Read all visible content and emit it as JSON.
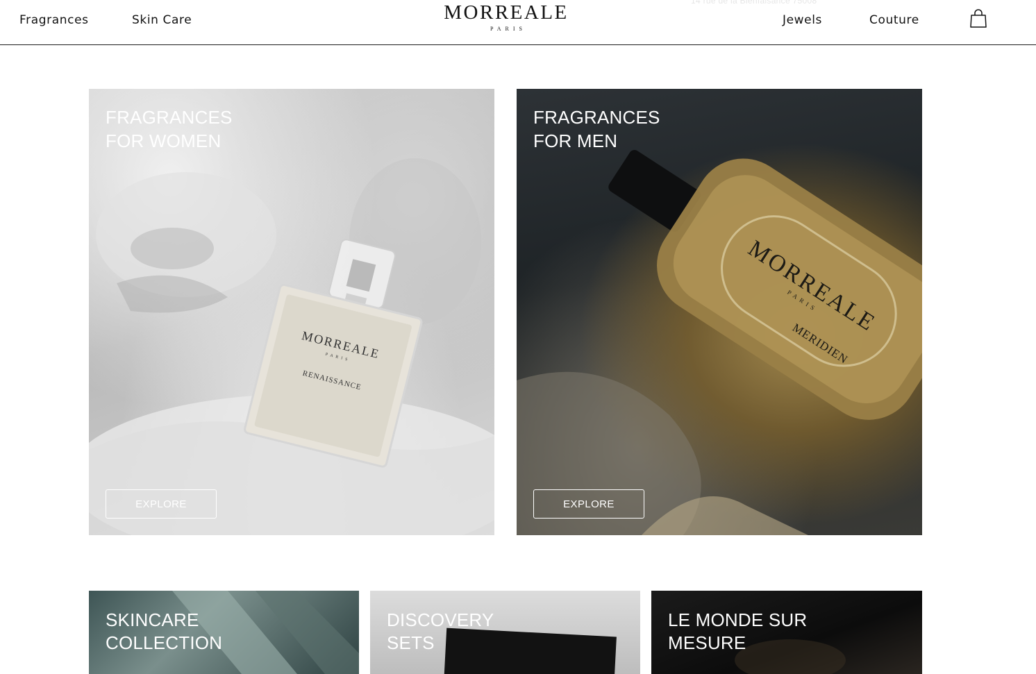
{
  "header": {
    "nav_left": [
      "Fragrances",
      "Skin Care"
    ],
    "nav_right": [
      "Jewels",
      "Couture"
    ],
    "logo_main": "MORREALE",
    "logo_sub": "PARIS",
    "ghost_text": "14 rue de la Bienfaisance 75008",
    "cart_icon": "shopping-bag-icon"
  },
  "cards": {
    "women": {
      "title": "FRAGRANCES\nFOR WOMEN",
      "button": "EXPLORE",
      "bottle_brand": "MORREALE",
      "bottle_sub": "PARIS",
      "bottle_name": "RENAISSANCE"
    },
    "men": {
      "title": "FRAGRANCES\nFOR MEN",
      "button": "EXPLORE",
      "bottle_brand": "MORREALE",
      "bottle_sub": "PARIS",
      "bottle_name": "MERIDIEN"
    },
    "skincare": {
      "title": "SKINCARE\nCOLLECTION"
    },
    "discovery": {
      "title": "DISCOVERY\nSETS"
    },
    "monde": {
      "title": "LE MONDE SUR\nMESURE"
    }
  },
  "colors": {
    "text": "#111111",
    "overlay_text": "#ffffff",
    "divider": "#1a1a1a"
  }
}
